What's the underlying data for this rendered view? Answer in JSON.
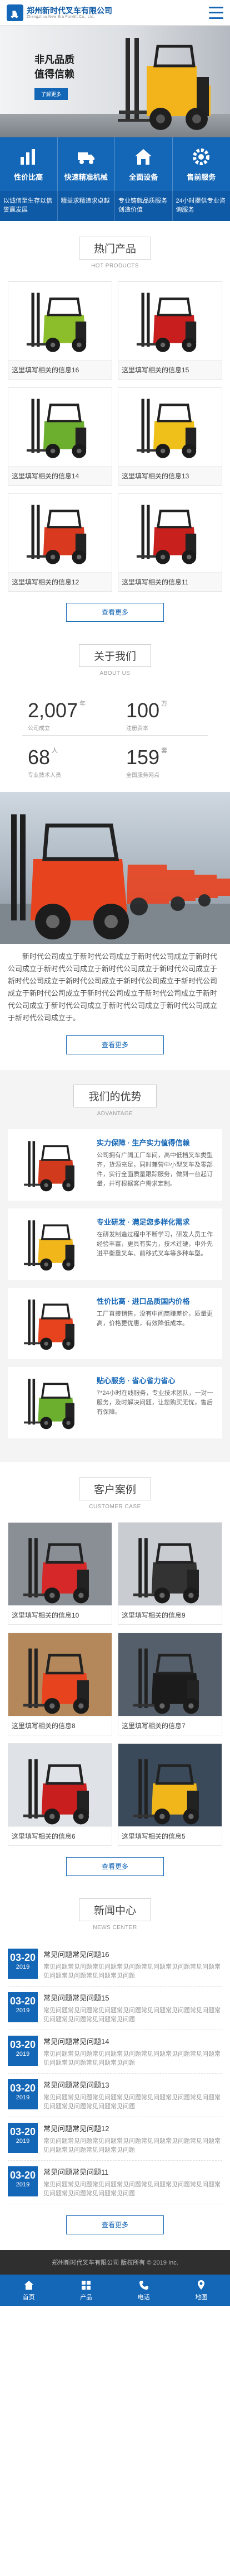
{
  "header": {
    "company": "郑州新时代叉车有限公司",
    "company_en": "Zhengzhou New Era Forklift Co., Ltd."
  },
  "banner": {
    "line1": "非凡品质",
    "line2": "值得信赖",
    "button": "了解更多"
  },
  "nav": [
    {
      "label": "性价比高",
      "icon": "chart-icon"
    },
    {
      "label": "快速精准机械",
      "icon": "truck-icon"
    },
    {
      "label": "全面设备",
      "icon": "home-icon"
    },
    {
      "label": "售前服务",
      "icon": "gear-icon"
    }
  ],
  "features": [
    "以诚信至生存以信誉赢发展",
    "精益求精追求卓越",
    "专业铸就品质服务创造价值",
    "24小时提供专业咨询服务"
  ],
  "products": {
    "title": "热门产品",
    "subtitle": "HOT PRODUCTS",
    "items": [
      {
        "label": "这里填写相关的信息16",
        "color": "#8cbd2a"
      },
      {
        "label": "这里填写相关的信息15",
        "color": "#c81e1e"
      },
      {
        "label": "这里填写相关的信息14",
        "color": "#6cae2e"
      },
      {
        "label": "这里填写相关的信息13",
        "color": "#f0c01a"
      },
      {
        "label": "这里填写相关的信息12",
        "color": "#d93a1f"
      },
      {
        "label": "这里填写相关的信息11",
        "color": "#c8201c"
      }
    ],
    "more": "查看更多"
  },
  "about": {
    "title": "关于我们",
    "subtitle": "ABOUT US",
    "stats": [
      {
        "num": "2,007",
        "sup": "年",
        "label": "公司成立"
      },
      {
        "num": "100",
        "sup": "万",
        "label": "注册资本"
      },
      {
        "num": "68",
        "sup": "人",
        "label": "专业技术人员"
      },
      {
        "num": "159",
        "sup": "套",
        "label": "全国服务网点"
      }
    ],
    "text": "新时代公司成立于新时代公司成立于新时代公司成立于新时代公司成立于新时代公司成立于新时代公司成立于新时代公司成立于新时代公司成立于新时代公司成立于新时代公司成立于新时代公司成立于新时代公司成立于新时代公司成立于新时代公司成立于新时代公司成立于新时代公司成立于新时代公司成立于新时代公司成立于新时代公司成立于。",
    "more": "查看更多"
  },
  "advantages": {
    "title": "我们的优势",
    "subtitle": "ADVANTAGE",
    "items": [
      {
        "title": "实力保障 · 生产实力值得信赖",
        "desc": "公司拥有广阔工厂车间，高中低档叉车类型齐，货源充足，同时兼营中小型叉车及零部件，实行全面质量跟踪服务，做到一台起订量，并可根据客户需求定制。"
      },
      {
        "title": "专业研发 · 满足您多样化需求",
        "desc": "在研发制造过程中不断学习，研发人员工作经验丰富，更具有实力，技术过硬，中外先进平衡重叉车、前移式叉车等多种车型。"
      },
      {
        "title": "性价比高 · 进口品质国内价格",
        "desc": "工厂直接销售，没有中间商赚差价，质量更高，价格更优惠，有效降低成本。"
      },
      {
        "title": "贴心服务 · 省心省力省心",
        "desc": "7*24小时在线服务，专业技术团队，一对一服务，及时解决问题，让您购买无忧，售后有保障。"
      }
    ]
  },
  "cases": {
    "title": "客户案例",
    "subtitle": "CUSTOMER CASE",
    "items": [
      {
        "label": "这里填写相关的信息10"
      },
      {
        "label": "这里填写相关的信息9"
      },
      {
        "label": "这里填写相关的信息8"
      },
      {
        "label": "这里填写相关的信息7"
      },
      {
        "label": "这里填写相关的信息6"
      },
      {
        "label": "这里填写相关的信息5"
      }
    ],
    "more": "查看更多"
  },
  "news": {
    "title": "新闻中心",
    "subtitle": "NEWS CENTER",
    "items": [
      {
        "day": "03-20",
        "year": "2019",
        "title": "常见问题常见问题16",
        "summary": "常见问题常见问题常见问题常见问题常见问题常见问题常见问题常见问题常见问题常见问题常见问题"
      },
      {
        "day": "03-20",
        "year": "2019",
        "title": "常见问题常见问题15",
        "summary": "常见问题常见问题常见问题常见问题常见问题常见问题常见问题常见问题常见问题常见问题常见问题"
      },
      {
        "day": "03-20",
        "year": "2019",
        "title": "常见问题常见问题14",
        "summary": "常见问题常见问题常见问题常见问题常见问题常见问题常见问题常见问题常见问题常见问题常见问题"
      },
      {
        "day": "03-20",
        "year": "2019",
        "title": "常见问题常见问题13",
        "summary": "常见问题常见问题常见问题常见问题常见问题常见问题常见问题常见问题常见问题常见问题常见问题"
      },
      {
        "day": "03-20",
        "year": "2019",
        "title": "常见问题常见问题12",
        "summary": "常见问题常见问题常见问题常见问题常见问题常见问题常见问题常见问题常见问题常见问题常见问题"
      },
      {
        "day": "03-20",
        "year": "2019",
        "title": "常见问题常见问题11",
        "summary": "常见问题常见问题常见问题常见问题常见问题常见问题常见问题常见问题常见问题常见问题常见问题"
      }
    ],
    "more": "查看更多"
  },
  "footer": {
    "copyright": "郑州新时代叉车有限公司  版权所有 © 2019 Inc."
  },
  "tabbar": [
    {
      "label": "首页",
      "icon": "home-icon"
    },
    {
      "label": "产品",
      "icon": "grid-icon"
    },
    {
      "label": "电话",
      "icon": "phone-icon"
    },
    {
      "label": "地图",
      "icon": "map-icon"
    }
  ]
}
